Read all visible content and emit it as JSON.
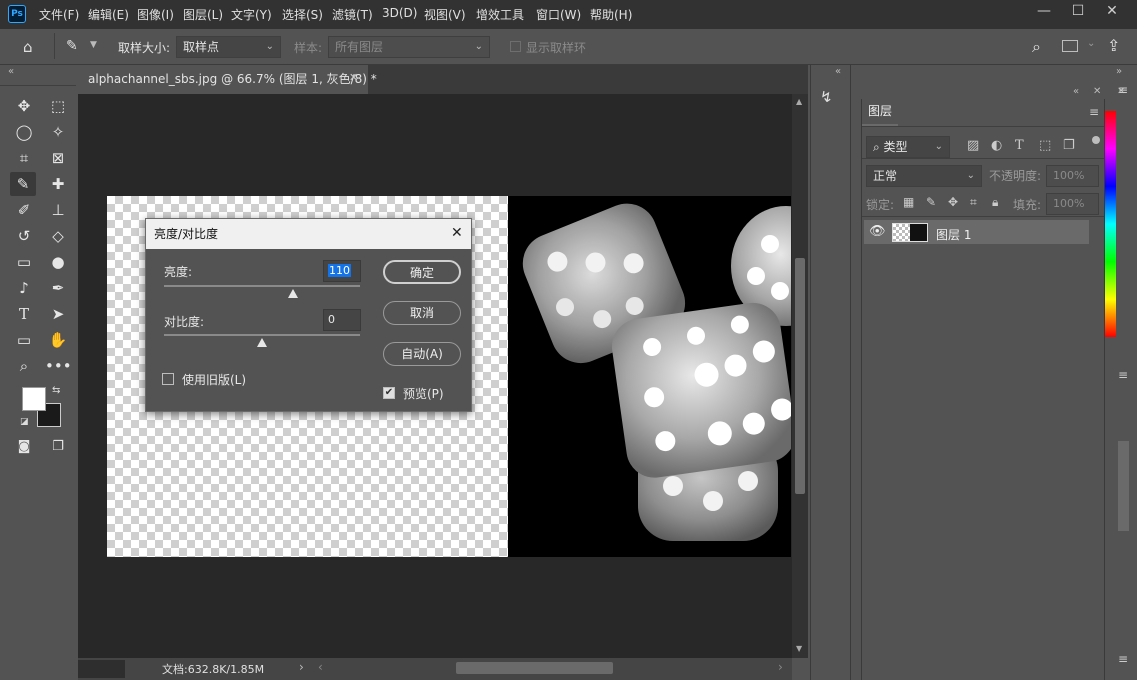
{
  "menubar": {
    "logo": "Ps",
    "items": [
      "文件(F)",
      "编辑(E)",
      "图像(I)",
      "图层(L)",
      "文字(Y)",
      "选择(S)",
      "滤镜(T)",
      "3D(D)",
      "视图(V)",
      "增效工具",
      "窗口(W)",
      "帮助(H)"
    ]
  },
  "options": {
    "sample_size_label": "取样大小:",
    "sample_size_value": "取样点",
    "sample_label": "样本:",
    "sample_value": "所有图层",
    "show_ring_label": "显示取样环"
  },
  "document": {
    "tab_title": "alphachannel_sbs.jpg @ 66.7% (图层 1, 灰色/8) *",
    "status": "文档:632.8K/1.85M"
  },
  "dialog": {
    "title": "亮度/对比度",
    "brightness_label": "亮度:",
    "brightness_value": "110",
    "brightness_level": 0.66,
    "contrast_label": "对比度:",
    "contrast_value": "0",
    "contrast_level": 0.5,
    "use_legacy_label": "使用旧版(L)",
    "use_legacy_checked": false,
    "preview_label": "预览(P)",
    "preview_checked": true,
    "ok_label": "确定",
    "cancel_label": "取消",
    "auto_label": "自动(A)"
  },
  "layers_panel": {
    "tab": "图层",
    "filter_kind": "类型",
    "blend_mode": "正常",
    "opacity_label": "不透明度:",
    "opacity_value": "100%",
    "lock_label": "锁定:",
    "fill_label": "填充:",
    "fill_value": "100%",
    "layer_name": "图层 1"
  },
  "colors": {
    "accent": "#31a8ff",
    "selected_layer": "#6a6a6a"
  }
}
